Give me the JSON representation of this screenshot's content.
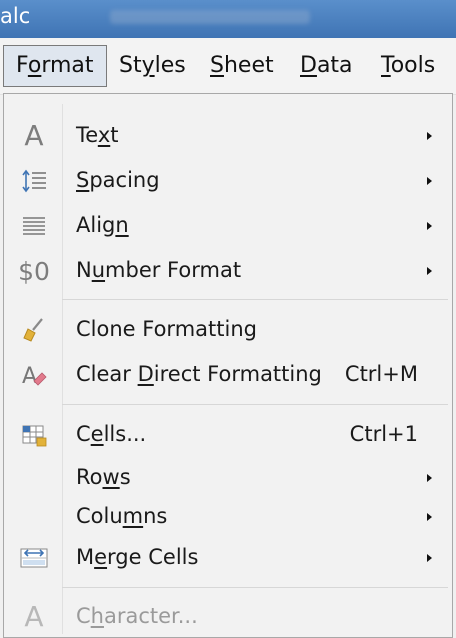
{
  "window": {
    "title": "alc"
  },
  "menubar": {
    "items": [
      {
        "pre": "F",
        "acc": "o",
        "post": "rmat",
        "active": true
      },
      {
        "pre": "St",
        "acc": "y",
        "post": "les"
      },
      {
        "pre": "",
        "acc": "S",
        "post": "heet"
      },
      {
        "pre": "",
        "acc": "D",
        "post": "ata"
      },
      {
        "pre": "",
        "acc": "T",
        "post": "ools"
      }
    ]
  },
  "format_menu": {
    "items": [
      {
        "pre": "Te",
        "acc": "x",
        "post": "t",
        "shortcut": "",
        "submenu": true,
        "icon": "text-a-icon",
        "glyph": "A"
      },
      {
        "pre": "",
        "acc": "S",
        "post": "pacing",
        "shortcut": "",
        "submenu": true,
        "icon": "line-spacing-icon"
      },
      {
        "pre": "Alig",
        "acc": "n",
        "post": "",
        "shortcut": "",
        "submenu": true,
        "icon": "align-icon"
      },
      {
        "pre": "N",
        "acc": "u",
        "post": "mber Format",
        "shortcut": "",
        "submenu": true,
        "icon": "currency-icon",
        "glyph": "$0"
      },
      {
        "pre": "Clone Formatting",
        "acc": "",
        "post": "",
        "shortcut": "",
        "submenu": false,
        "icon": "paintbrush-icon"
      },
      {
        "pre": "Clear ",
        "acc": "D",
        "post": "irect Formatting",
        "shortcut": "Ctrl+M",
        "submenu": false,
        "icon": "clear-formatting-icon"
      },
      {
        "pre": "C",
        "acc": "e",
        "post": "lls...",
        "shortcut": "Ctrl+1",
        "submenu": false,
        "icon": "cells-icon"
      },
      {
        "pre": "Ro",
        "acc": "w",
        "post": "s",
        "shortcut": "",
        "submenu": true,
        "icon": ""
      },
      {
        "pre": "Colu",
        "acc": "m",
        "post": "ns",
        "shortcut": "",
        "submenu": true,
        "icon": ""
      },
      {
        "pre": "M",
        "acc": "e",
        "post": "rge Cells",
        "shortcut": "",
        "submenu": true,
        "icon": "merge-cells-icon"
      },
      {
        "pre": "C",
        "acc": "h",
        "post": "aracter...",
        "shortcut": "",
        "submenu": false,
        "icon": "character-icon",
        "glyph": "A",
        "disabled": true
      }
    ]
  },
  "colors": {
    "accent_blue": "#3f74b4",
    "menu_bg": "#f2f2f2",
    "brush_yellow": "#e2b23a",
    "eraser_pink": "#e27a8c"
  }
}
